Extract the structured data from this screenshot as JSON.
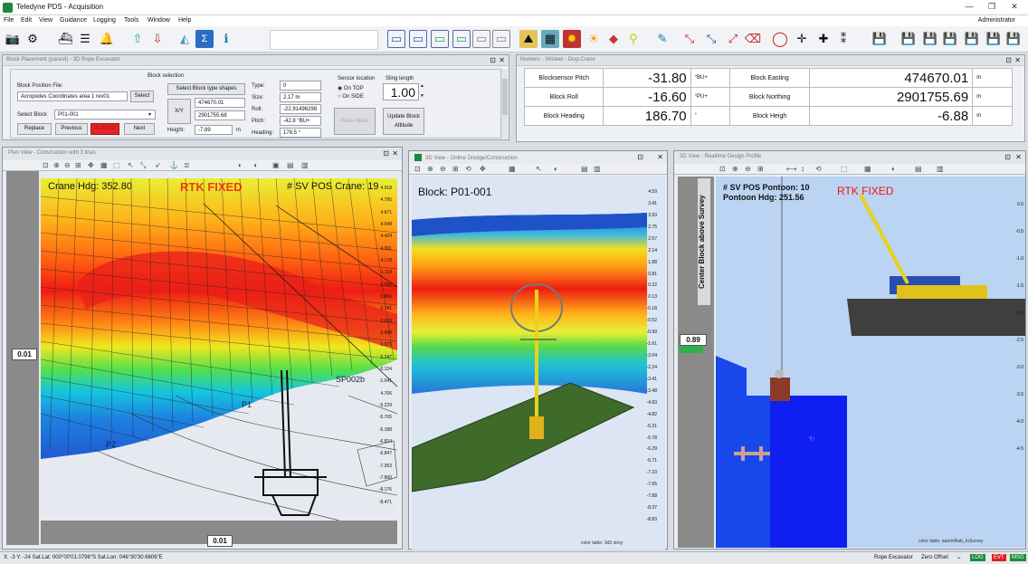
{
  "window": {
    "title": "Teledyne PDS - Acquisition",
    "admin": "Administrator"
  },
  "menu": [
    "File",
    "Edit",
    "View",
    "Guidance",
    "Logging",
    "Tools",
    "Window",
    "Help"
  ],
  "block_panel": {
    "title": "Block Placement (parasit) - 3D Rope Excavator",
    "position_file_label": "Block Position File:",
    "position_file_value": "Acropodes Coordinates area 1 rev01",
    "select_button": "Select",
    "select_block_label": "Select Block",
    "select_block_value": "P01-001",
    "replace": "Replace",
    "previous": "Previous",
    "placed": "PLACED",
    "next": "Next",
    "block_selection_label": "Block selection",
    "select_type_button": "Select Block type shapes",
    "xy_label": "X/Y",
    "x_value": "474670.01",
    "y_value": "2901755.68",
    "height_label": "Height:",
    "height_value": "-7.89",
    "height_unit": "m",
    "type_label": "Type:",
    "type_value": "0",
    "size_label": "Size:",
    "size_value": "2.17 m",
    "roll_label": "Roll:",
    "roll_value": "-22.91496298",
    "pitch_label": "Pitch:",
    "pitch_value": "-42.8 °BU+",
    "heading_label": "Heading:",
    "heading_value": "178.5 °",
    "sensor_label": "Sensor location",
    "on_top": "On TOP",
    "on_side": "On SIDE",
    "sling_label": "Sling length",
    "sling_value": "1.00",
    "place_button": "Place Block",
    "update_button": "Update Block Attitude"
  },
  "meas_panel": {
    "title": "Numeric - Wisteel - Disp.Crane",
    "rows": [
      {
        "l1": "Blocksensor Pitch",
        "v1": "-31.80",
        "u1": "°BU+",
        "l2": "Block Easting",
        "v2": "474670.01",
        "u2": "m"
      },
      {
        "l1": "Block Roll",
        "v1": "-16.60",
        "u1": "°PU+",
        "l2": "Block Northing",
        "v2": "2901755.69",
        "u2": "m"
      },
      {
        "l1": "Block Heading",
        "v1": "186.70",
        "u1": "°",
        "l2": "Block Heigh",
        "v2": "-6.88",
        "u2": "m"
      }
    ]
  },
  "plan_view": {
    "title": "Plan View - Construction with 3 lines",
    "crane_hdg": "Crane Hdg: 352.80",
    "rtk": "RTK FIXED",
    "sv_pos": "# SV POS Crane: 19",
    "left_value": "0.01",
    "bottom_value": "0.01",
    "labels": {
      "p1": "P1",
      "p2": "P2",
      "sp": "SP002b"
    },
    "scale": [
      "4.918",
      "4.795",
      "4.671",
      "4.548",
      "4.424",
      "4.301",
      "4.178",
      "1.118",
      "0.988",
      "0.865",
      "0.741",
      "0.618",
      "0.494",
      "0.371",
      "0.247",
      "-0.124",
      "-1.041",
      "4.706",
      "-5.229",
      "-5.765",
      "-5.188",
      "-6.824",
      "-6.847",
      "-7.353",
      "-7.860",
      "-8.176",
      "-8.471"
    ]
  },
  "view3d": {
    "title": "3D View - Online Dredge/Construction",
    "block": "Block: P01-001",
    "footer": "color table: 3d3 stroy",
    "scale": [
      "4.59",
      "3.41",
      "3.93",
      "2.75",
      "2.57",
      "2.14",
      "1.88",
      "0.81",
      "0.22",
      "0.13",
      "-0.18",
      "-0.52",
      "-0.99",
      "-1.61",
      "-2.04",
      "-2.24",
      "-3.41",
      "-3.48",
      "-4.93",
      "-4.82",
      "-5.31",
      "-5.78",
      "-6.29",
      "-6.71",
      "-7.10",
      "-7.65",
      "-7.88",
      "-8.37",
      "-8.83"
    ]
  },
  "view3b": {
    "title": "3D View - Realtime Design Profile",
    "sv_pos": "# SV POS Pontoon: 10",
    "pontoon_hdg": "Pontoon Hdg: 251.56",
    "rtk": "RTK FIXED",
    "side_label": "Center Block above Survey",
    "left_value": "0.89",
    "footer": "color table: automRab_InSurvey",
    "scale": [
      "0.0",
      "-0.5",
      "-1.0",
      "-1.5",
      "-2.0",
      "-2.5",
      "-3.0",
      "-3.5",
      "-4.0",
      "-4.5"
    ]
  },
  "status": {
    "left": "X: -3  Y: -24 Sat.Lat: 000°00'01.0796\"S Sat.Lon: 046°30'30.6606\"E",
    "mode": "Rope Excavator",
    "offset": "Zero Offset",
    "log": "LOG",
    "evt": "EVT",
    "msg": "MSG"
  }
}
